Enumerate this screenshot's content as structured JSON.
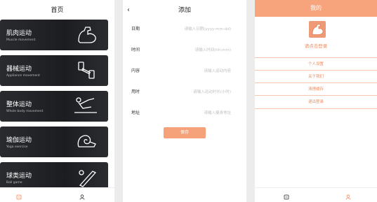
{
  "home": {
    "title": "首页",
    "cards": [
      {
        "name": "肌肉运动",
        "sub": "Muscle movement",
        "icon": "flexed-arm-icon"
      },
      {
        "name": "器械运动",
        "sub": "Appliance movement",
        "icon": "dumbbell-icon"
      },
      {
        "name": "整体运动",
        "sub": "Whole body movement",
        "icon": "rowing-icon"
      },
      {
        "name": "瑜伽运动",
        "sub": "Yoga exercise",
        "icon": "yoga-mat-icon"
      },
      {
        "name": "球类运动",
        "sub": "Ball game",
        "icon": "baseball-bat-icon"
      }
    ],
    "tabs": [
      {
        "label": "首页"
      },
      {
        "label": "我的"
      }
    ]
  },
  "add": {
    "title": "添加",
    "back": "‹",
    "fields": [
      {
        "label": "日期",
        "placeholder": "请输入日期(yyyy-mm-dd)"
      },
      {
        "label": "时间",
        "placeholder": "请输入时间(hh:mm)"
      },
      {
        "label": "内容",
        "placeholder": "请输入运动内容"
      },
      {
        "label": "用时",
        "placeholder": "请输入运动时长(小时)"
      },
      {
        "label": "地址",
        "placeholder": "请输入健身地址"
      }
    ],
    "save": "保存"
  },
  "mine": {
    "title": "我的",
    "login": "请点击登录",
    "menu": [
      "个人设置",
      "关于我们",
      "清理缓存",
      "退出登录"
    ],
    "tabs": [
      {
        "label": "首页"
      },
      {
        "label": "我的"
      }
    ]
  },
  "colors": {
    "accent": "#f28a5a",
    "header": "#f7a47c",
    "card": "#1f2023"
  }
}
